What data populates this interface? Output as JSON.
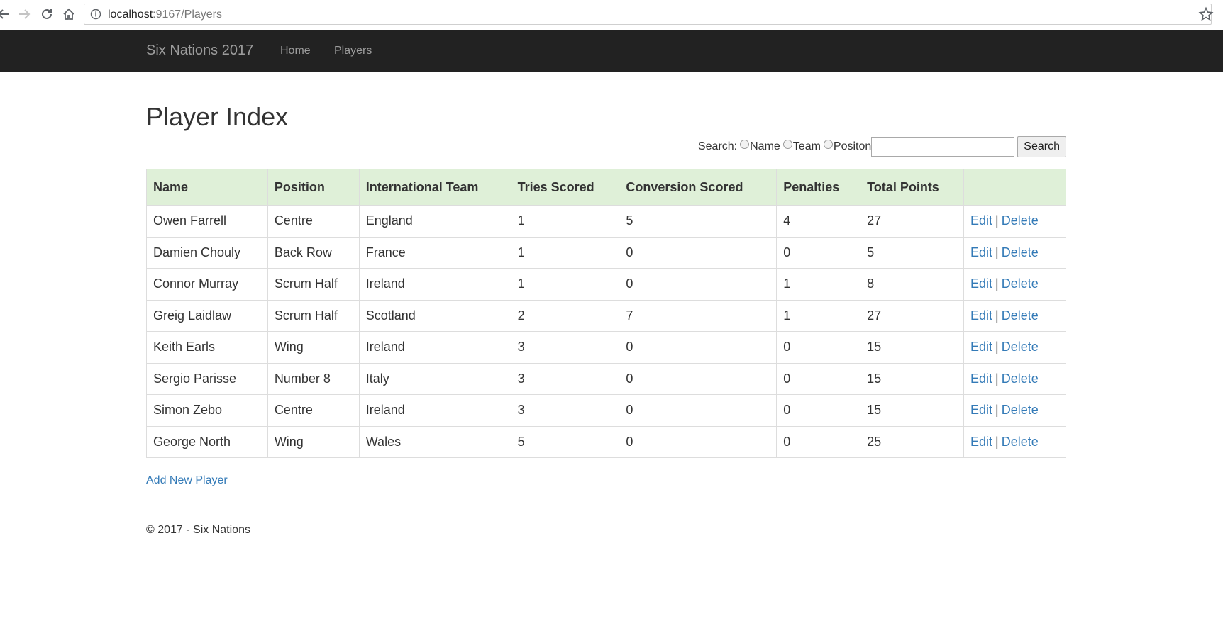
{
  "browser": {
    "url_host": "localhost",
    "url_rest": ":9167/Players"
  },
  "navbar": {
    "brand": "Six Nations 2017",
    "links": [
      "Home",
      "Players"
    ]
  },
  "page": {
    "title": "Player Index"
  },
  "search": {
    "label": "Search:",
    "options": [
      "Name",
      "Team",
      "Positon"
    ],
    "input_value": "",
    "button_label": "Search"
  },
  "table": {
    "headers": [
      "Name",
      "Position",
      "International Team",
      "Tries Scored",
      "Conversion Scored",
      "Penalties",
      "Total Points",
      ""
    ],
    "rows": [
      [
        "Owen Farrell",
        "Centre",
        "England",
        "1",
        "5",
        "4",
        "27"
      ],
      [
        "Damien Chouly",
        "Back Row",
        "France",
        "1",
        "0",
        "0",
        "5"
      ],
      [
        "Connor Murray",
        "Scrum Half",
        "Ireland",
        "1",
        "0",
        "1",
        "8"
      ],
      [
        "Greig Laidlaw",
        "Scrum Half",
        "Scotland",
        "2",
        "7",
        "1",
        "27"
      ],
      [
        "Keith Earls",
        "Wing",
        "Ireland",
        "3",
        "0",
        "0",
        "15"
      ],
      [
        "Sergio Parisse",
        "Number 8",
        "Italy",
        "3",
        "0",
        "0",
        "15"
      ],
      [
        "Simon Zebo",
        "Centre",
        "Ireland",
        "3",
        "0",
        "0",
        "15"
      ],
      [
        "George North",
        "Wing",
        "Wales",
        "5",
        "0",
        "0",
        "25"
      ]
    ],
    "edit_label": "Edit",
    "separator": "|",
    "delete_label": "Delete"
  },
  "add_link": "Add New Player",
  "footer": "© 2017 - Six Nations",
  "colors": {
    "navbar_bg": "#222222",
    "header_bg": "#dff0d8",
    "link": "#337ab7"
  }
}
